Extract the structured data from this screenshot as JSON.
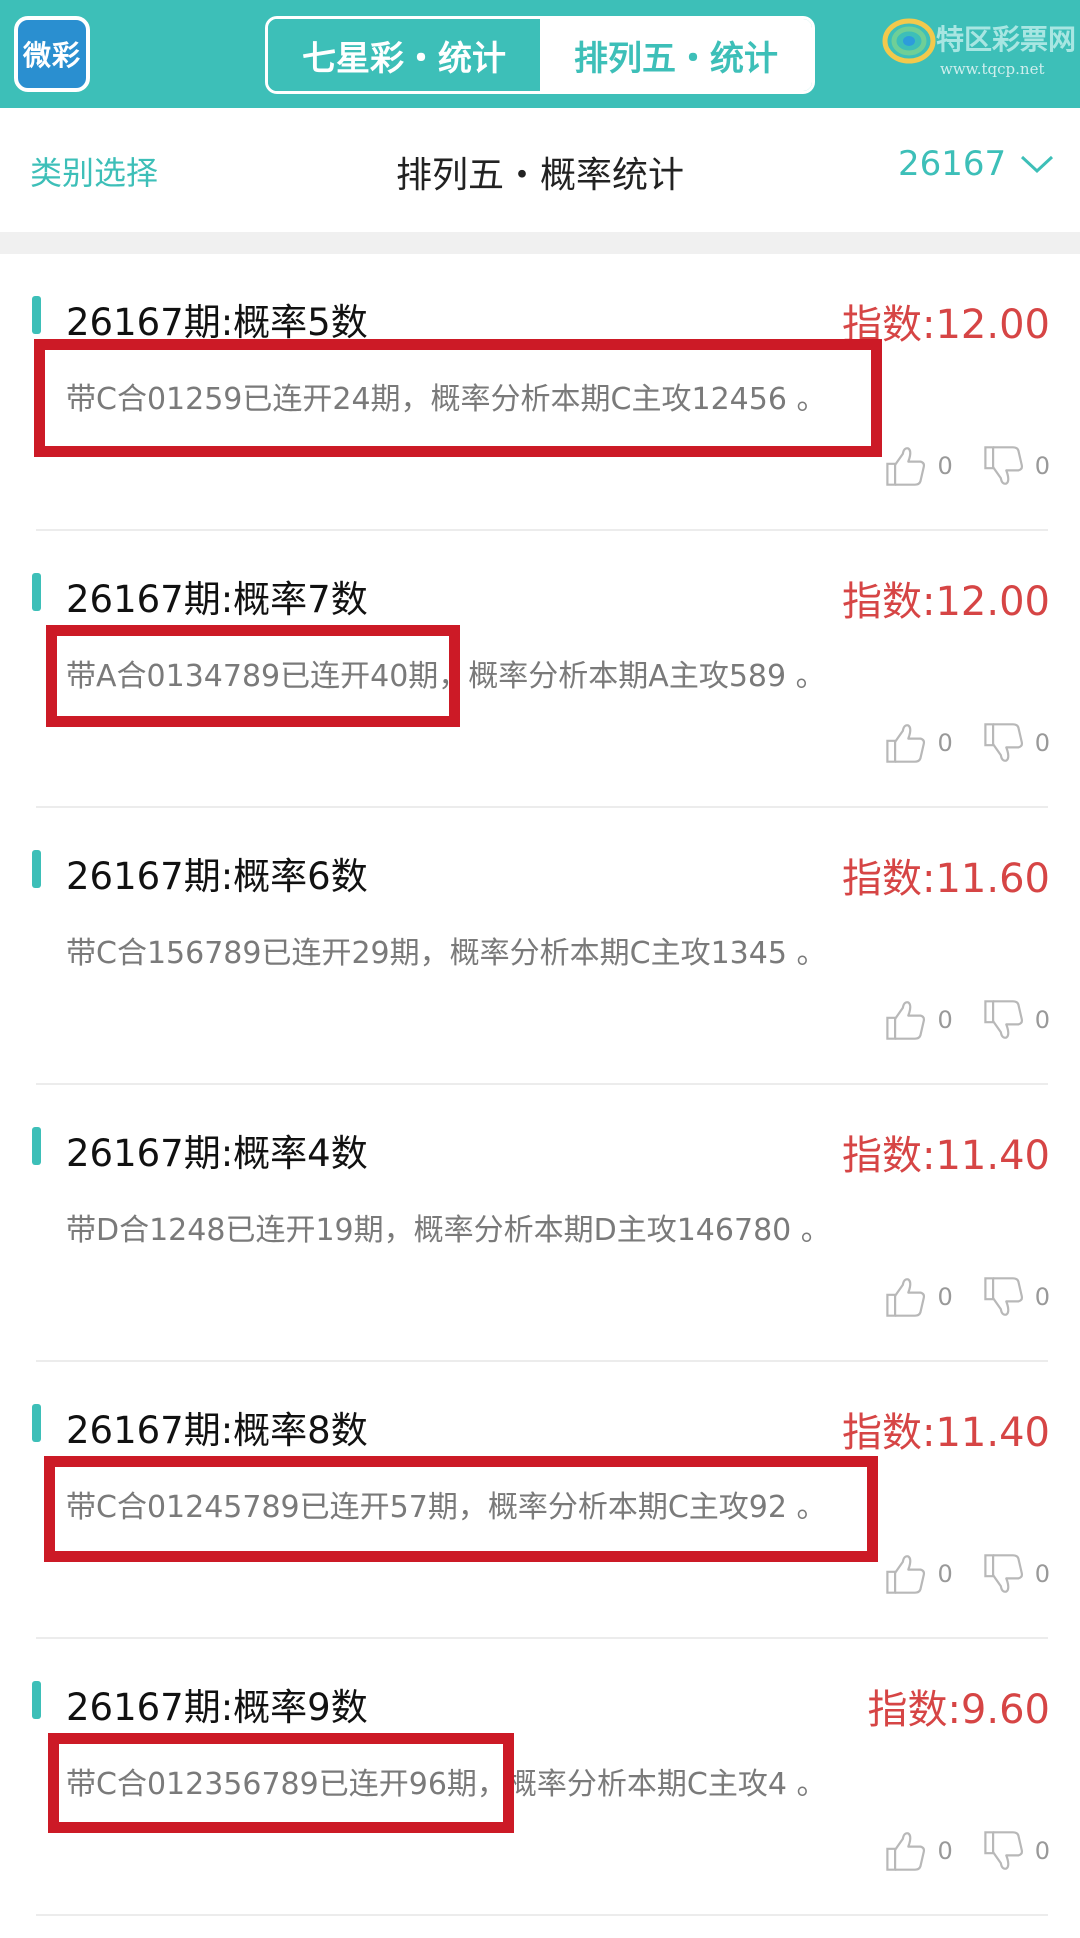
{
  "header": {
    "logo_text": "微彩",
    "tabs": [
      {
        "label": "七星彩・统计",
        "active": false
      },
      {
        "label": "排列五・统计",
        "active": true
      }
    ],
    "brand_name": "特区彩票网",
    "brand_url": "www.tqcp.net",
    "accent_color": "#3dbfb8"
  },
  "subheader": {
    "category_label": "类别选择",
    "title": "排列五・概率统计",
    "issue": "26167"
  },
  "items": [
    {
      "title": "26167期:概率5数",
      "index": "指数:12.00",
      "desc": "带C合01259已连开24期，概率分析本期C主攻12456 。",
      "likes": "0",
      "dislikes": "0"
    },
    {
      "title": "26167期:概率7数",
      "index": "指数:12.00",
      "desc": "带A合0134789已连开40期，概率分析本期A主攻589 。",
      "likes": "0",
      "dislikes": "0"
    },
    {
      "title": "26167期:概率6数",
      "index": "指数:11.60",
      "desc": "带C合156789已连开29期，概率分析本期C主攻1345 。",
      "likes": "0",
      "dislikes": "0"
    },
    {
      "title": "26167期:概率4数",
      "index": "指数:11.40",
      "desc": "带D合1248已连开19期，概率分析本期D主攻146780 。",
      "likes": "0",
      "dislikes": "0"
    },
    {
      "title": "26167期:概率8数",
      "index": "指数:11.40",
      "desc": "带C合01245789已连开57期，概率分析本期C主攻92 。",
      "likes": "0",
      "dislikes": "0"
    },
    {
      "title": "26167期:概率9数",
      "index": "指数:9.60",
      "desc": "带C合012356789已连开96期，概率分析本期C主攻4 。",
      "likes": "0",
      "dislikes": "0"
    }
  ],
  "colors": {
    "index_red": "#d64545",
    "highlight_red": "#cc1a26"
  }
}
